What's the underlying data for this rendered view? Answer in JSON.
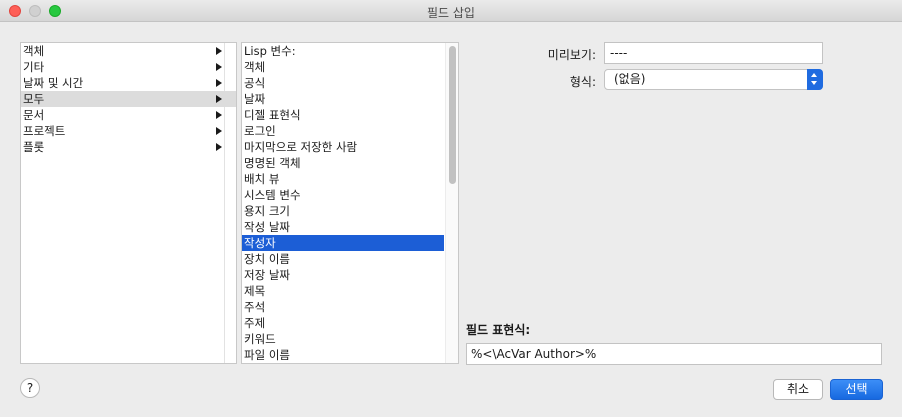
{
  "window": {
    "title": "필드 삽입"
  },
  "categories": {
    "items": [
      {
        "label": "객체",
        "has_submenu": true,
        "selected": false
      },
      {
        "label": "기타",
        "has_submenu": true,
        "selected": false
      },
      {
        "label": "날짜 및 시간",
        "has_submenu": true,
        "selected": false
      },
      {
        "label": "모두",
        "has_submenu": true,
        "selected": true
      },
      {
        "label": "문서",
        "has_submenu": true,
        "selected": false
      },
      {
        "label": "프로젝트",
        "has_submenu": true,
        "selected": false
      },
      {
        "label": "플롯",
        "has_submenu": true,
        "selected": false
      }
    ]
  },
  "fields": {
    "items": [
      {
        "label": "Lisp 변수:",
        "selected": false
      },
      {
        "label": "객체",
        "selected": false
      },
      {
        "label": "공식",
        "selected": false
      },
      {
        "label": "날짜",
        "selected": false
      },
      {
        "label": "디젤 표현식",
        "selected": false
      },
      {
        "label": "로그인",
        "selected": false
      },
      {
        "label": "마지막으로 저장한 사람",
        "selected": false
      },
      {
        "label": "명명된 객체",
        "selected": false
      },
      {
        "label": "배치 뷰",
        "selected": false
      },
      {
        "label": "시스템 변수",
        "selected": false
      },
      {
        "label": "용지 크기",
        "selected": false
      },
      {
        "label": "작성 날짜",
        "selected": false
      },
      {
        "label": "작성자",
        "selected": true
      },
      {
        "label": "장치 이름",
        "selected": false
      },
      {
        "label": "저장 날짜",
        "selected": false
      },
      {
        "label": "제목",
        "selected": false
      },
      {
        "label": "주석",
        "selected": false
      },
      {
        "label": "주제",
        "selected": false
      },
      {
        "label": "키워드",
        "selected": false
      },
      {
        "label": "파일 이름",
        "selected": false
      }
    ]
  },
  "preview": {
    "label": "미리보기:",
    "value": "----"
  },
  "format": {
    "label": "형식:",
    "value": "(없음)"
  },
  "expression": {
    "label": "필드 표현식:",
    "value": "%<\\AcVar Author>%"
  },
  "buttons": {
    "help": "?",
    "cancel": "취소",
    "select": "선택"
  },
  "colors": {
    "accent": "#1c5ed6",
    "selection_gray": "#dcdcdc"
  }
}
